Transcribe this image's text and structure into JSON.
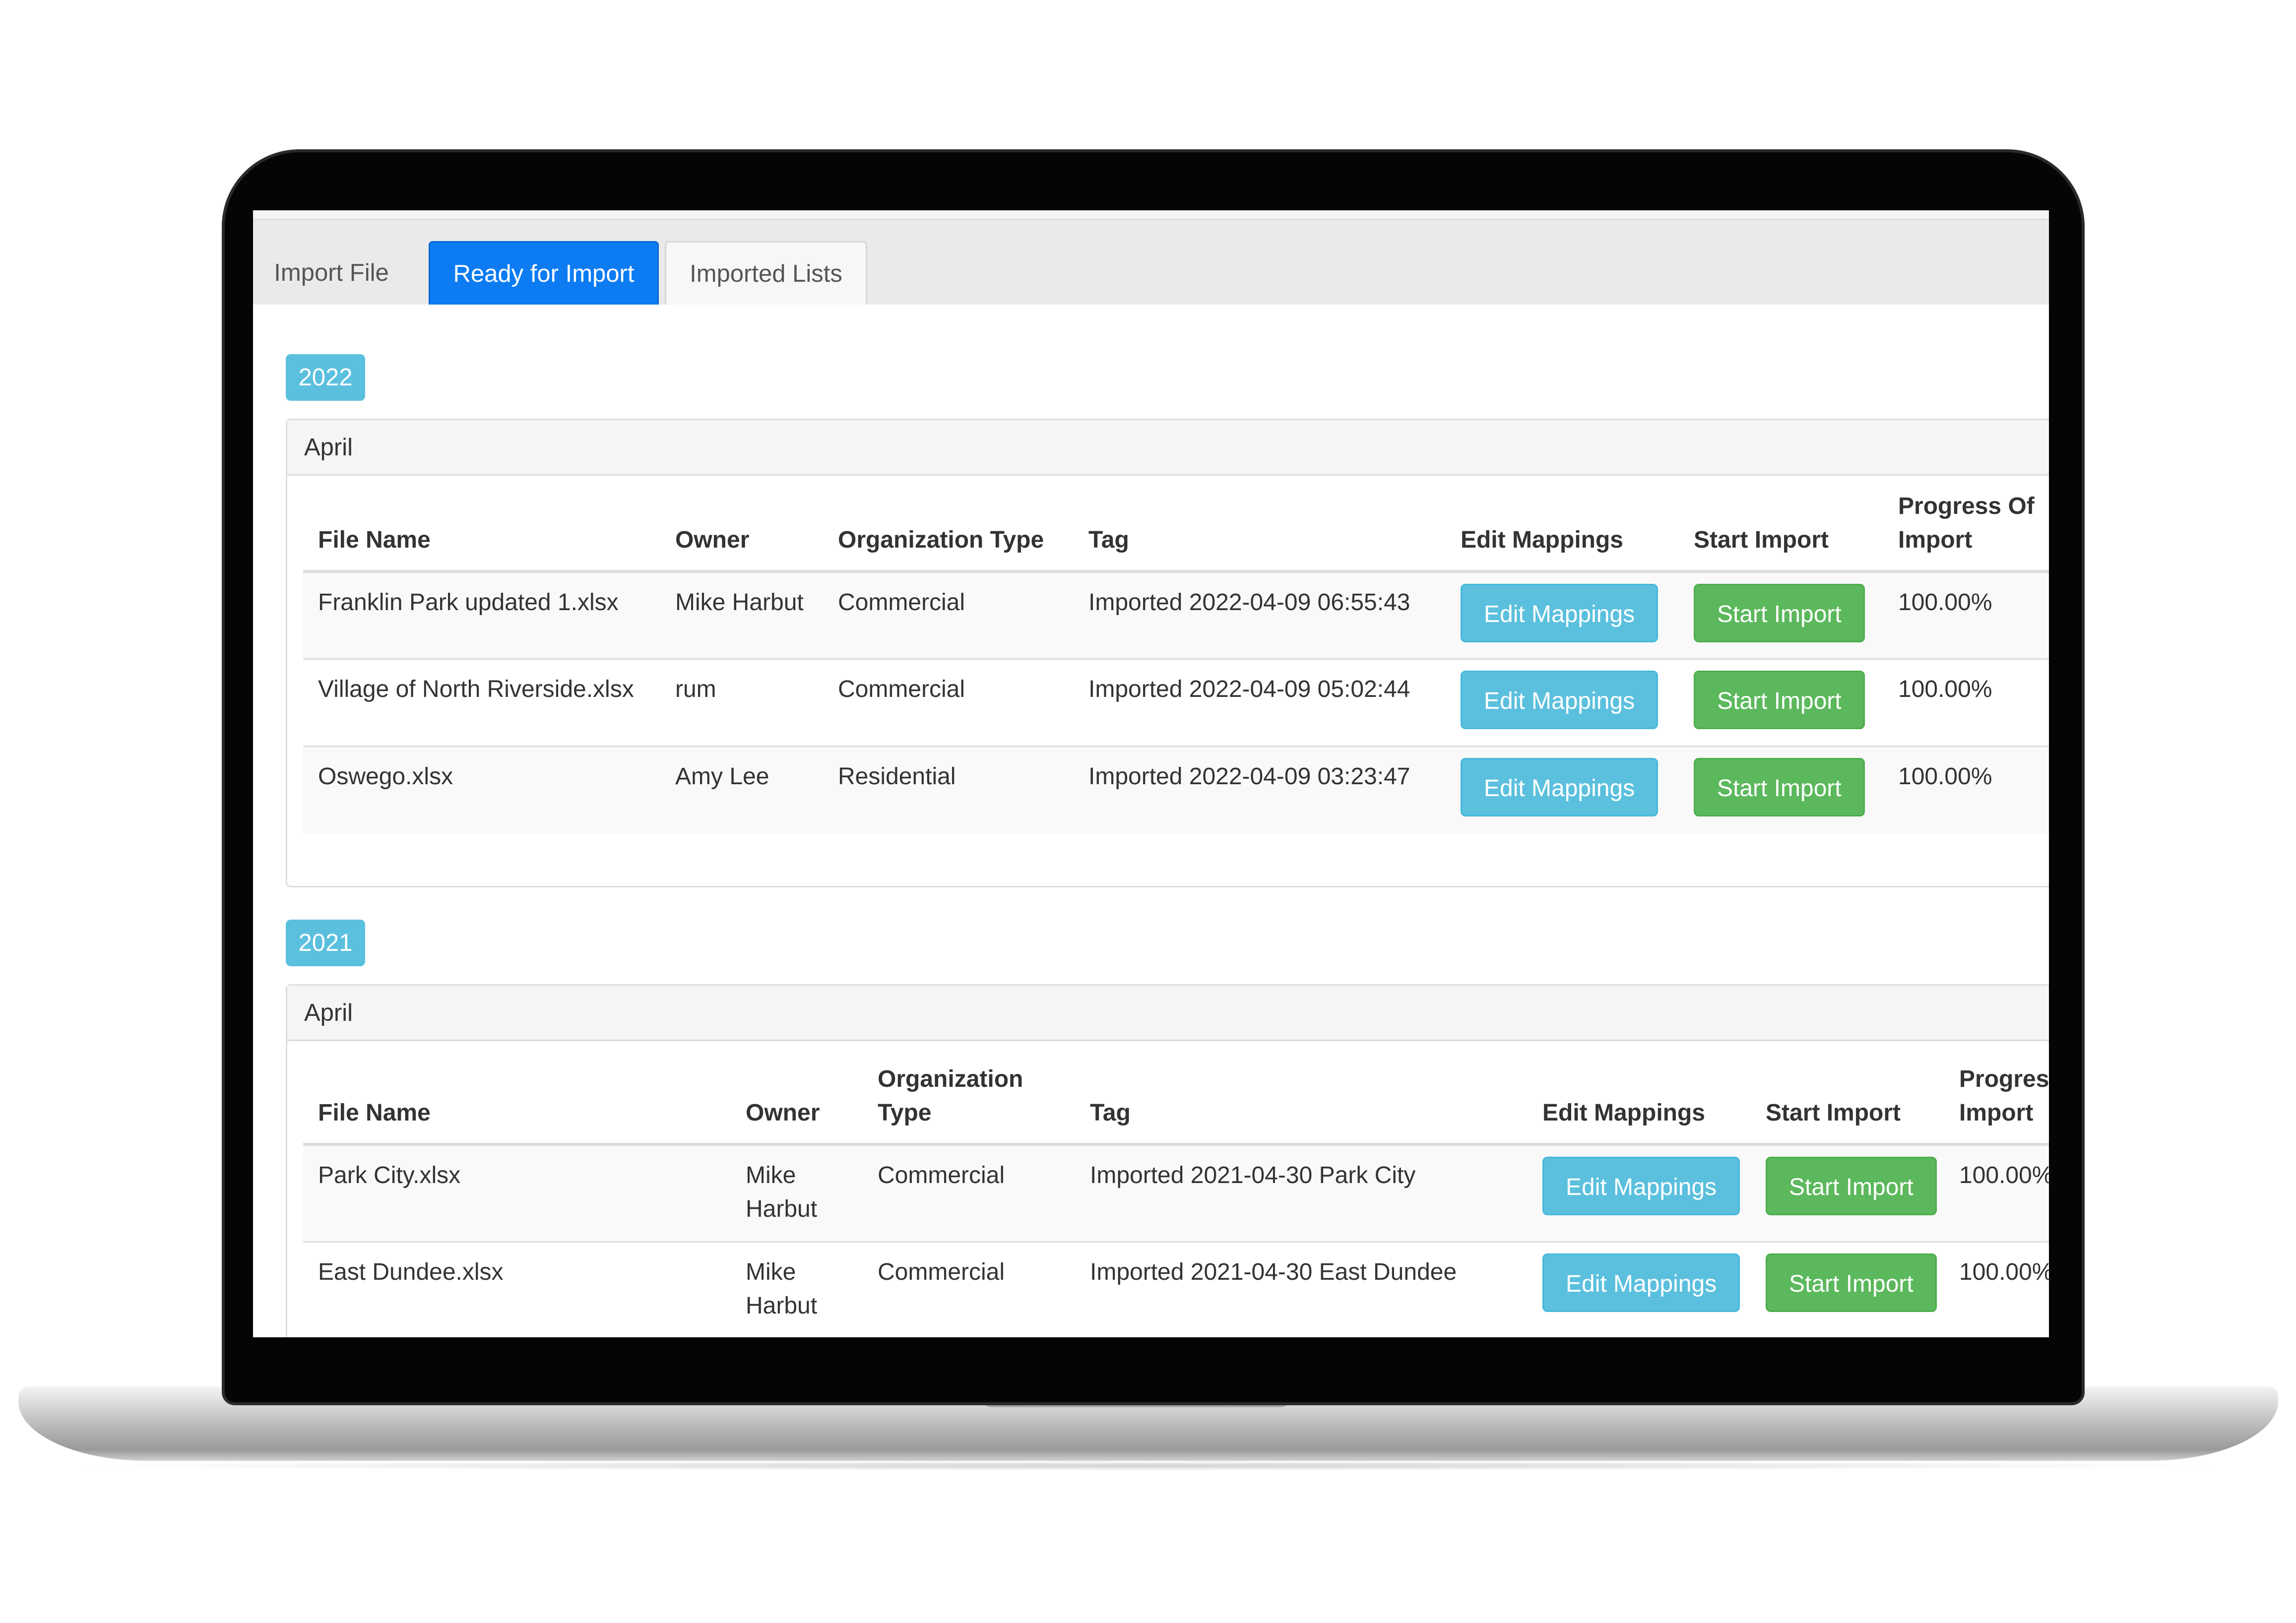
{
  "tabs": [
    {
      "label": "Import File",
      "state": "plain"
    },
    {
      "label": "Ready for Import",
      "state": "active"
    },
    {
      "label": "Imported Lists",
      "state": "bordered"
    }
  ],
  "columns_2022": [
    "File Name",
    "Owner",
    "Organization Type",
    "Tag",
    "Edit Mappings",
    "Start Import",
    "Progress Of Import"
  ],
  "columns_2021": [
    "File Name",
    "Owner",
    "Organization Type",
    "Tag",
    "Edit Mappings",
    "Start Import",
    "Progress Of Import"
  ],
  "buttons": {
    "edit": "Edit Mappings",
    "start": "Start Import"
  },
  "colors": {
    "active_tab": "#0d7cf2",
    "info": "#5bc0de",
    "success": "#5cb85c"
  },
  "groups": [
    {
      "year": "2022",
      "month": "April",
      "rows": [
        {
          "file": "Franklin Park updated 1.xlsx",
          "owner": "Mike Harbut",
          "org": "Commercial",
          "tag": "Imported 2022-04-09 06:55:43",
          "progress": "100.00%"
        },
        {
          "file": "Village of North Riverside.xlsx",
          "owner": "rum",
          "org": "Commercial",
          "tag": "Imported 2022-04-09 05:02:44",
          "progress": "100.00%"
        },
        {
          "file": "Oswego.xlsx",
          "owner": "Amy Lee",
          "org": "Residential",
          "tag": "Imported 2022-04-09 03:23:47",
          "progress": "100.00%"
        }
      ]
    },
    {
      "year": "2021",
      "month": "April",
      "rows": [
        {
          "file": "Park City.xlsx",
          "owner": "Mike Harbut",
          "org": "Commercial",
          "tag": "Imported 2021-04-30 Park City",
          "progress": "100.00%"
        },
        {
          "file": "East Dundee.xlsx",
          "owner": "Mike Harbut",
          "org": "Commercial",
          "tag": "Imported 2021-04-30 East Dundee",
          "progress": "100.00%"
        }
      ]
    }
  ]
}
